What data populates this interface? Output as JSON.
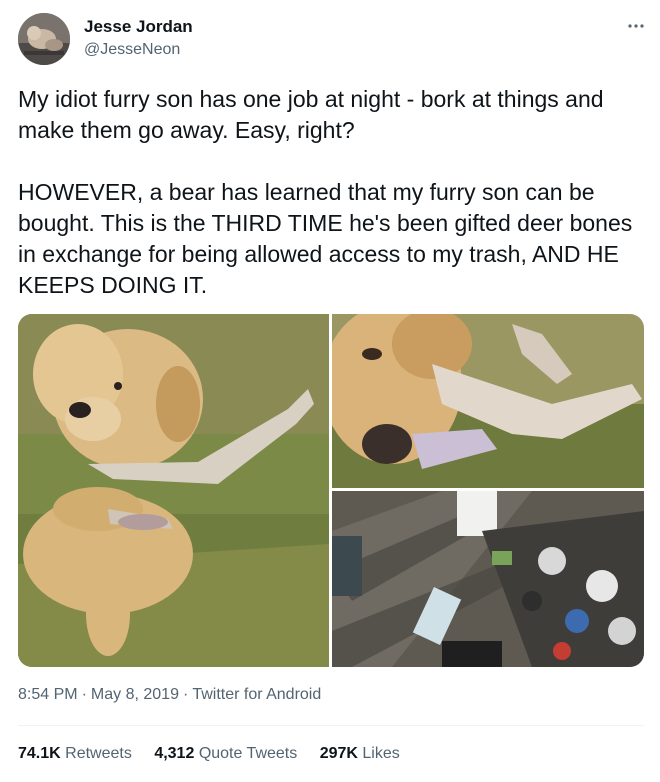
{
  "author": {
    "name": "Jesse Jordan",
    "handle": "@JesseNeon",
    "avatar_icon": "user-avatar"
  },
  "menu": {
    "icon": "more-dots-icon"
  },
  "tweet": {
    "paragraph1": "My idiot furry son has one job at night - bork at things and make them go away. Easy, right?",
    "paragraph2": "HOWEVER, a bear has learned that my furry son can be bought. This is the THIRD TIME he's been gifted deer bones in exchange for being allowed access to my trash, AND HE KEEPS DOING IT."
  },
  "media": {
    "photos": [
      "dog-with-deer-bone",
      "dog-chewing-bone-closeup",
      "trash-scattered-on-deck"
    ]
  },
  "meta": {
    "time": "8:54 PM",
    "date": "May 8, 2019",
    "source": "Twitter for Android",
    "separator": "·"
  },
  "stats": {
    "retweets_count": "74.1K",
    "retweets_label": "Retweets",
    "quotes_count": "4,312",
    "quotes_label": "Quote Tweets",
    "likes_count": "297K",
    "likes_label": "Likes"
  },
  "colors": {
    "text": "#0f1419",
    "secondary": "#536471",
    "divider": "#eff3f4"
  }
}
